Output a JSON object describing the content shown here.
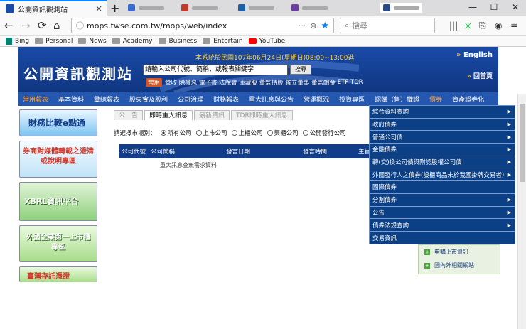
{
  "browser": {
    "tab_title": "公開資訊觀測站",
    "new_tab_symbol": "+",
    "url": "mops.twse.com.tw/mops/web/index",
    "search_placeholder": "搜尋",
    "bookmarks": [
      "Bing",
      "Personal",
      "News",
      "Academy",
      "Business",
      "Entertain",
      "YouTube"
    ],
    "colors": {
      "accent": "#0a84ff",
      "youtube": "#ff0000",
      "bing": "#008373"
    }
  },
  "site": {
    "logo": "公開資訊觀測站",
    "system_note": "本系統於民國107年06月24日(星期日)08:00~13:00進",
    "english": "English",
    "home": "回首頁",
    "search_placeholder": "請輸入公司代號、簡稱，或報表關鍵字",
    "search_button": "搜尋",
    "common_label": "常用",
    "common_links": [
      "營收",
      "除權息",
      "電子書",
      "法說會",
      "庫藏股",
      "董監持股",
      "獨立董事",
      "董監酬金",
      "ETF",
      "TDR"
    ],
    "nav": [
      "常用報表",
      "基本資料",
      "彙總報表",
      "股東會及股利",
      "公司治理",
      "財務報表",
      "重大訊息與公告",
      "營運概況",
      "投資專區",
      "認購（售）權證",
      "債券",
      "資產證券化"
    ],
    "banners": [
      "財務比較e點通",
      "券商對媒體轉載之澄清或說明專區",
      "XBRL資訊平台",
      "外國企業第一上市櫃專區",
      "臺灣存託憑證"
    ],
    "subtabs": [
      "公　告",
      "即時重大訊息",
      "最新資訊",
      "TDR即時重大訊息"
    ],
    "market_label": "請選擇市場別：",
    "markets": [
      "所有公司",
      "上市公司",
      "上櫃公司",
      "興櫃公司",
      "公開發行公司"
    ],
    "table_headers": [
      "公司代號",
      "公司簡稱",
      "發言日期",
      "發言時間",
      "主旨"
    ],
    "notice": "重大訊息查無需求資料",
    "dropdown": [
      {
        "label": "綜合資料查詢",
        "submenu": true
      },
      {
        "label": "政府債券",
        "submenu": true
      },
      {
        "label": "普通公司債",
        "submenu": true
      },
      {
        "label": "金融債券",
        "submenu": true
      },
      {
        "label": "轉(交)換公司債與附認股權公司債",
        "submenu": true
      },
      {
        "label": "外國發行人之債券(設櫃商品未於我國掛牌交易者)",
        "submenu": true
      },
      {
        "label": "國際債券",
        "submenu": false
      },
      {
        "label": "分割債券",
        "submenu": true
      },
      {
        "label": "公告",
        "submenu": true
      },
      {
        "label": "債券法規查詢",
        "submenu": true
      },
      {
        "label": "交易資訊",
        "submenu": false
      }
    ],
    "right_links": [
      "申購上市資訊",
      "國內外相關網站"
    ],
    "colors": {
      "header": "#1a4aa8",
      "nav": "#2457b0",
      "dropdown": "#0b3f86",
      "hot": "#ff9d2c",
      "note": "#ffd23c"
    }
  }
}
